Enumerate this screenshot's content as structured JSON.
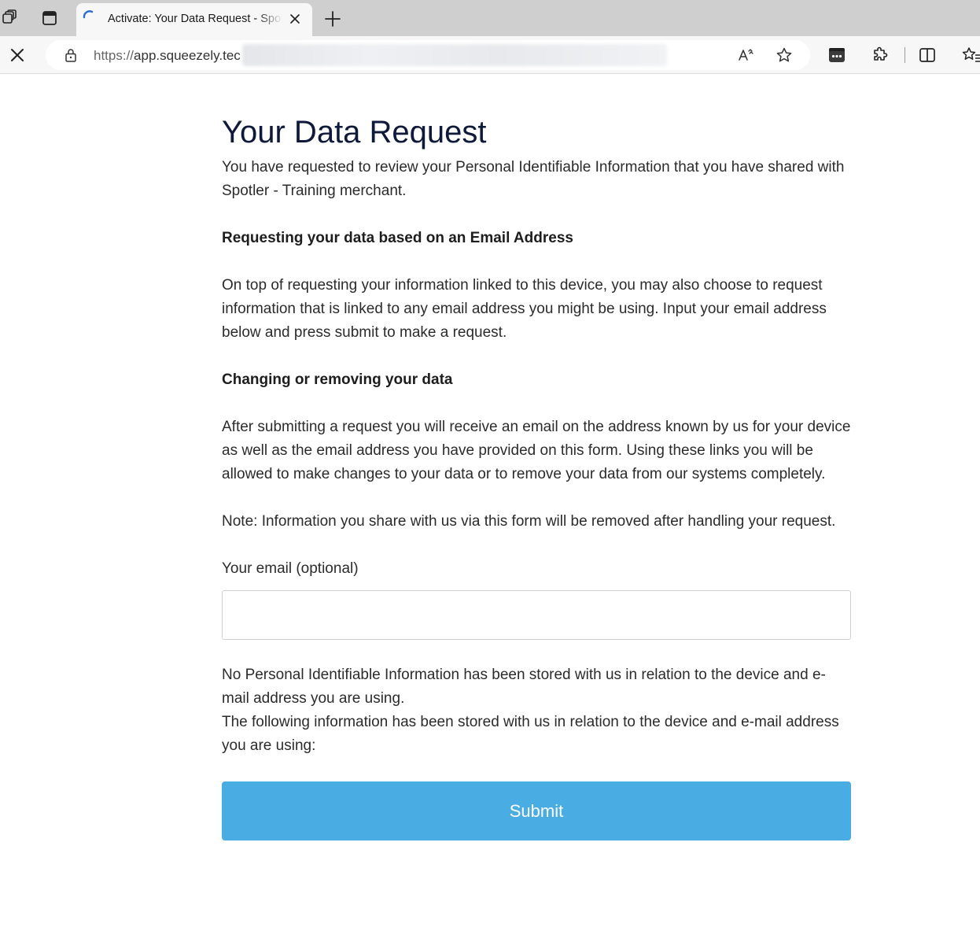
{
  "browser": {
    "tab_title": "Activate: Your Data Request - Spotler",
    "url_scheme": "https://",
    "url_host": "app.squeezely.tec",
    "icons": {
      "workspaces": "workspaces-icon",
      "tab_actions": "tab-actions-icon",
      "loading": "loading-spinner-icon",
      "close_tab": "close-icon",
      "new_tab": "plus-icon",
      "stop": "stop-icon",
      "lock": "lock-icon",
      "read_aloud": "read-aloud-icon",
      "favorite": "star-icon",
      "extension_dots": "extension-icon",
      "extensions": "puzzle-icon",
      "split_screen": "split-screen-icon",
      "favorites": "favorites-icon"
    }
  },
  "page": {
    "title": "Your Data Request",
    "intro": "You have requested to review your Personal Identifiable Information that you have shared with Spotler - Training merchant.",
    "email_heading": "Requesting your data based on an Email Address",
    "email_text": "On top of requesting your information linked to this device, you may also choose to request information that is linked to any email address you might be using. Input your email address below and press submit to make a request.",
    "change_heading": "Changing or removing your data",
    "change_text": "After submitting a request you will receive an email on the address known by us for your device as well as the email address you have provided on this form. Using these links you will be allowed to make changes to your data or to remove your data from our systems completely.",
    "note": "Note: Information you share with us via this form will be removed after handling your request.",
    "email_label": "Your email (optional)",
    "email_value": "",
    "no_info_text": "No Personal Identifiable Information has been stored with us in relation to the device and e-mail address you are using.",
    "stored_info_text": "The following information has been stored with us in relation to the device and e-mail address you are using:",
    "submit_label": "Submit"
  },
  "colors": {
    "submit_bg": "#49ade3",
    "title": "#0f1a3a",
    "spinner": "#2a6bd6"
  }
}
